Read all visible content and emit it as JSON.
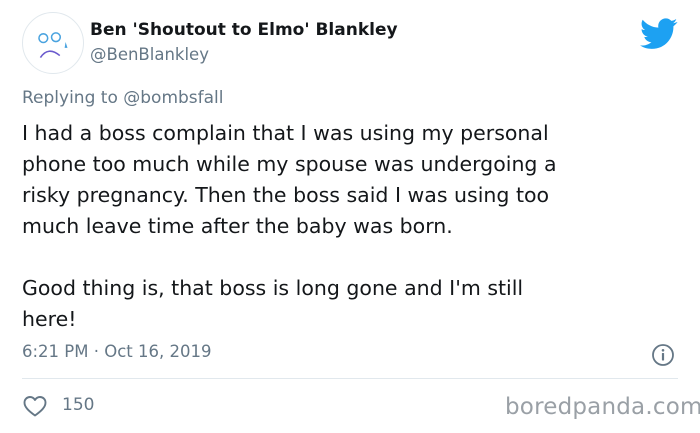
{
  "author": {
    "display_name": "Ben 'Shoutout to Elmo' Blankley",
    "handle": "@BenBlankley"
  },
  "reply_context": {
    "prefix": "Replying to ",
    "mention": "@bombsfall"
  },
  "tweet": {
    "lines": [
      "I had a boss complain that I was using my personal",
      "phone too much while my spouse was undergoing a",
      "risky pregnancy. Then the boss said I was using too",
      "much leave time after the baby was born.",
      "",
      "Good thing is, that boss is long gone and I'm still",
      "here!"
    ],
    "timestamp": "6:21 PM · Oct 16, 2019"
  },
  "engagement": {
    "likes": "150"
  },
  "watermark": "boredpanda.com",
  "icons": {
    "brand": "twitter-bird-icon",
    "info": "info-icon",
    "like": "heart-icon",
    "avatar": "sad-face-avatar"
  },
  "colors": {
    "twitter_blue": "#1da1f2",
    "secondary_text": "#657786",
    "primary_text": "#14171a",
    "divider": "#e1e8ed"
  }
}
